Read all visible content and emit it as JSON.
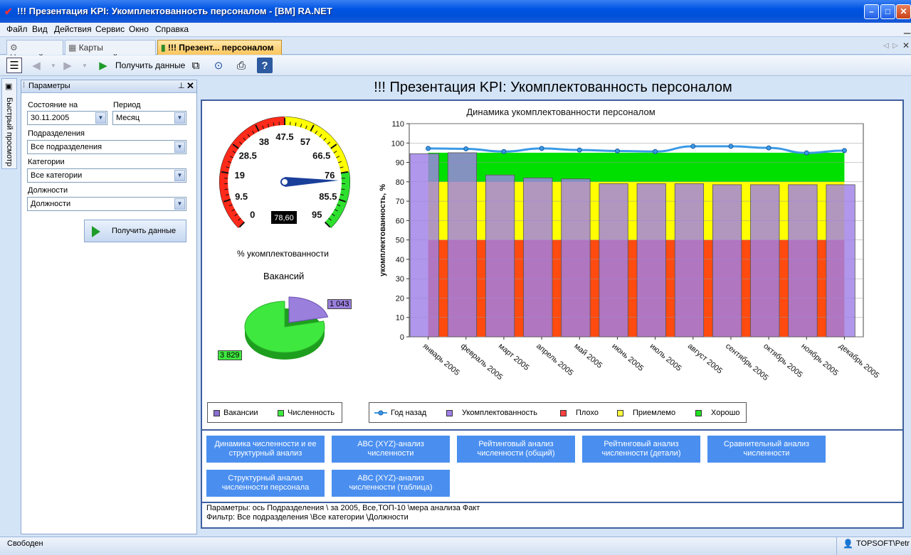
{
  "window": {
    "title": "!!! Презентация KPI: Укомплектованность персоналом - [BM] RA.NET",
    "app_icon": "check-icon"
  },
  "menu": [
    "Файл",
    "Вид",
    "Действия",
    "Сервис",
    "Окно",
    "Справка"
  ],
  "tabs": [
    {
      "label": "Настройка",
      "icon": "settings-icon"
    },
    {
      "label": "Карты показателей",
      "icon": "table-icon"
    },
    {
      "label": "!!! Презент... персоналом",
      "icon": "chart-icon",
      "active": true
    }
  ],
  "toolbar": {
    "get_data_label": "Получить данные"
  },
  "quick_view": {
    "label": "Быстрый просмотр"
  },
  "params": {
    "title": "Параметры",
    "state_label": "Состояние на",
    "state_value": "30.11.2005",
    "period_label": "Период",
    "period_value": "Месяц",
    "division_label": "Подразделения",
    "division_value": "Все подразделения",
    "category_label": "Категории",
    "category_value": "Все категории",
    "position_label": "Должности",
    "position_value": "Должности",
    "get_data_label": "Получить данные"
  },
  "main": {
    "title": "!!! Презентация KPI: Укомплектованность персоналом"
  },
  "gauge": {
    "label": "% укомплектованности",
    "value": 78.6,
    "value_text": "78,60",
    "ticks": [
      "0",
      "9.5",
      "19",
      "28.5",
      "38",
      "47.5",
      "57",
      "66.5",
      "76",
      "85.5",
      "95"
    ],
    "min": 0,
    "max": 95,
    "bands": [
      {
        "from": 0,
        "to": 47.5,
        "color": "#ff2a1a"
      },
      {
        "from": 47.5,
        "to": 76,
        "color": "#ffff00"
      },
      {
        "from": 76,
        "to": 95,
        "color": "#2ee02e"
      }
    ]
  },
  "pie": {
    "title": "Вакансий",
    "slices": [
      {
        "name": "Вакансии",
        "value": 1043,
        "label": "1 043",
        "color": "#9a7fdc"
      },
      {
        "name": "Численность",
        "value": 3829,
        "label": "3 829",
        "color": "#3fe83f"
      }
    ],
    "legend": [
      {
        "label": "Вакансии",
        "color": "#8a6fd0"
      },
      {
        "label": "Численность",
        "color": "#3fe83f"
      }
    ]
  },
  "chart_data": {
    "type": "bar",
    "title": "Динамика укомплектованности персоналом",
    "ylabel": "укомплектованность, %",
    "ylim": [
      0,
      110
    ],
    "yticks": [
      "0",
      "10",
      "20",
      "30",
      "40",
      "50",
      "60",
      "70",
      "80",
      "90",
      "100",
      "110"
    ],
    "categories": [
      "январь 2005",
      "февраль 2005",
      "март 2005",
      "апрель 2005",
      "май 2005",
      "июнь 2005",
      "июль 2005",
      "август 2005",
      "сентябрь 2005",
      "октябрь 2005",
      "ноябрь 2005",
      "декабрь 2005"
    ],
    "series": [
      {
        "name": "Укомплектованность",
        "type": "bar",
        "color": "#a080e8",
        "values": [
          94.5,
          95,
          83.5,
          82,
          81.5,
          79,
          79,
          79,
          78.5,
          78.5,
          78.5,
          78.5
        ]
      },
      {
        "name": "Год назад",
        "type": "line",
        "color": "#3a9ae6",
        "values": [
          97.2,
          97,
          95.6,
          97.2,
          96.4,
          95.9,
          95.6,
          98.3,
          98.3,
          97.5,
          94.9,
          96.1
        ]
      }
    ],
    "bands": [
      {
        "name": "Плохо",
        "from": 0,
        "to": 50,
        "color": "#ff4a10"
      },
      {
        "name": "Приемлемо",
        "from": 50,
        "to": 80,
        "color": "#ffff00"
      },
      {
        "name": "Хорошо",
        "from": 80,
        "to": 95,
        "color": "#00e000"
      }
    ],
    "legend": [
      {
        "label": "Год назад",
        "kind": "line",
        "color": "#3a9ae6"
      },
      {
        "label": "Укомплектованность",
        "kind": "box",
        "color": "#a080e8"
      },
      {
        "label": "Плохо",
        "kind": "box",
        "color": "#ff4040"
      },
      {
        "label": "Приемлемо",
        "kind": "box",
        "color": "#ffff40"
      },
      {
        "label": "Хорошо",
        "kind": "box",
        "color": "#20e020"
      }
    ]
  },
  "nav_buttons": [
    [
      "Динамика численности и ее",
      "структурный анализ"
    ],
    [
      "АВС (XYZ)-анализ",
      "численности"
    ],
    [
      "Рейтинговый анализ",
      "численности (общий)"
    ],
    [
      "Рейтинговый анализ",
      "численности (детали)"
    ],
    [
      "Сравнительный анализ",
      "численности"
    ],
    [
      "Структурный анализ",
      "численности персонала"
    ],
    [
      "АВС (XYZ)-анализ",
      "численности (таблица)"
    ]
  ],
  "footer": {
    "params_line": "Параметры: ось Подразделения \\ за 2005, Все,ТОП-10 \\мера анализа Факт",
    "filter_line": "Фильтр: Все подразделения \\Все категории \\Должности"
  },
  "status": {
    "text": "Свободен",
    "user": "TOPSOFT\\Petr"
  }
}
